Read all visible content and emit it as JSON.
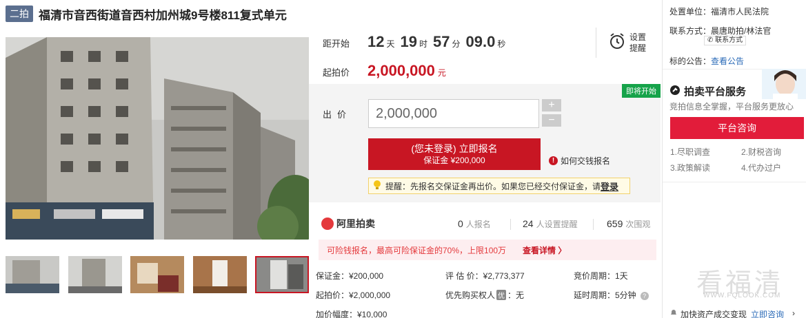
{
  "header": {
    "round_badge": "二拍",
    "title": "福清市音西街道音西村加州城9号楼811复式单元"
  },
  "countdown": {
    "label": "距开始",
    "days": "12",
    "days_unit": "天",
    "hours": "19",
    "hours_unit": "时",
    "minutes": "57",
    "minutes_unit": "分",
    "seconds": "09.0",
    "seconds_unit": "秒",
    "remind_label": "设置提醒"
  },
  "start_price": {
    "label": "起拍价",
    "value": "2,000,000",
    "unit": "元"
  },
  "bid": {
    "soon_tag": "即将开始",
    "label": "出价",
    "input_value": "2,000,000",
    "plus": "+",
    "minus": "−",
    "signup_main": "(您未登录) 立即报名",
    "signup_sub": "保证金 ¥200,000",
    "howto": "如何交钱报名",
    "tip_text": "提醒：先报名交保证金再出价。如果您已经交付保证金，请",
    "tip_login": "登录"
  },
  "stats": {
    "platform": "阿里拍卖",
    "signups": "0",
    "signups_label": "人报名",
    "reminders": "24",
    "reminders_label": "人设置提醒",
    "views": "659",
    "views_label": "次围观"
  },
  "deduct": {
    "text": "可险钱报名，最高可险保证金的70%，上限100万",
    "more": "查看详情 〉"
  },
  "details": {
    "deposit": "保证金：¥200,000",
    "appraise": "评 估 价：¥2,773,377",
    "period": "竞价周期：1天",
    "start": "起拍价：¥2,000,000",
    "priority_a": "优先购买权人",
    "priority_icon": "优",
    "priority_b": "：无",
    "extend": "延时周期：5分钟",
    "increment": "加价幅度：¥10,000"
  },
  "right": {
    "unit_label": "处置单位：",
    "unit_value": "福清市人民法院",
    "contact_label": "联系方式：",
    "contact_value": "晨唐助拍/林法官",
    "contact_btn": "联系方式",
    "notice_label": "标的公告：",
    "notice_link": "查看公告",
    "svc_title": "拍卖平台服务",
    "svc_sub": "竞拍信息全掌握，平台服务更放心",
    "consult": "平台咨询",
    "svc_items": [
      "1.尽职调查",
      "2.财税咨询",
      "3.政策解读",
      "4.代办过户"
    ],
    "footer_a": "加快资产成交变现",
    "footer_b": "立即咨询"
  },
  "watermark": {
    "main": "看福清",
    "sub": "WWW.FQLOOK.COM"
  }
}
